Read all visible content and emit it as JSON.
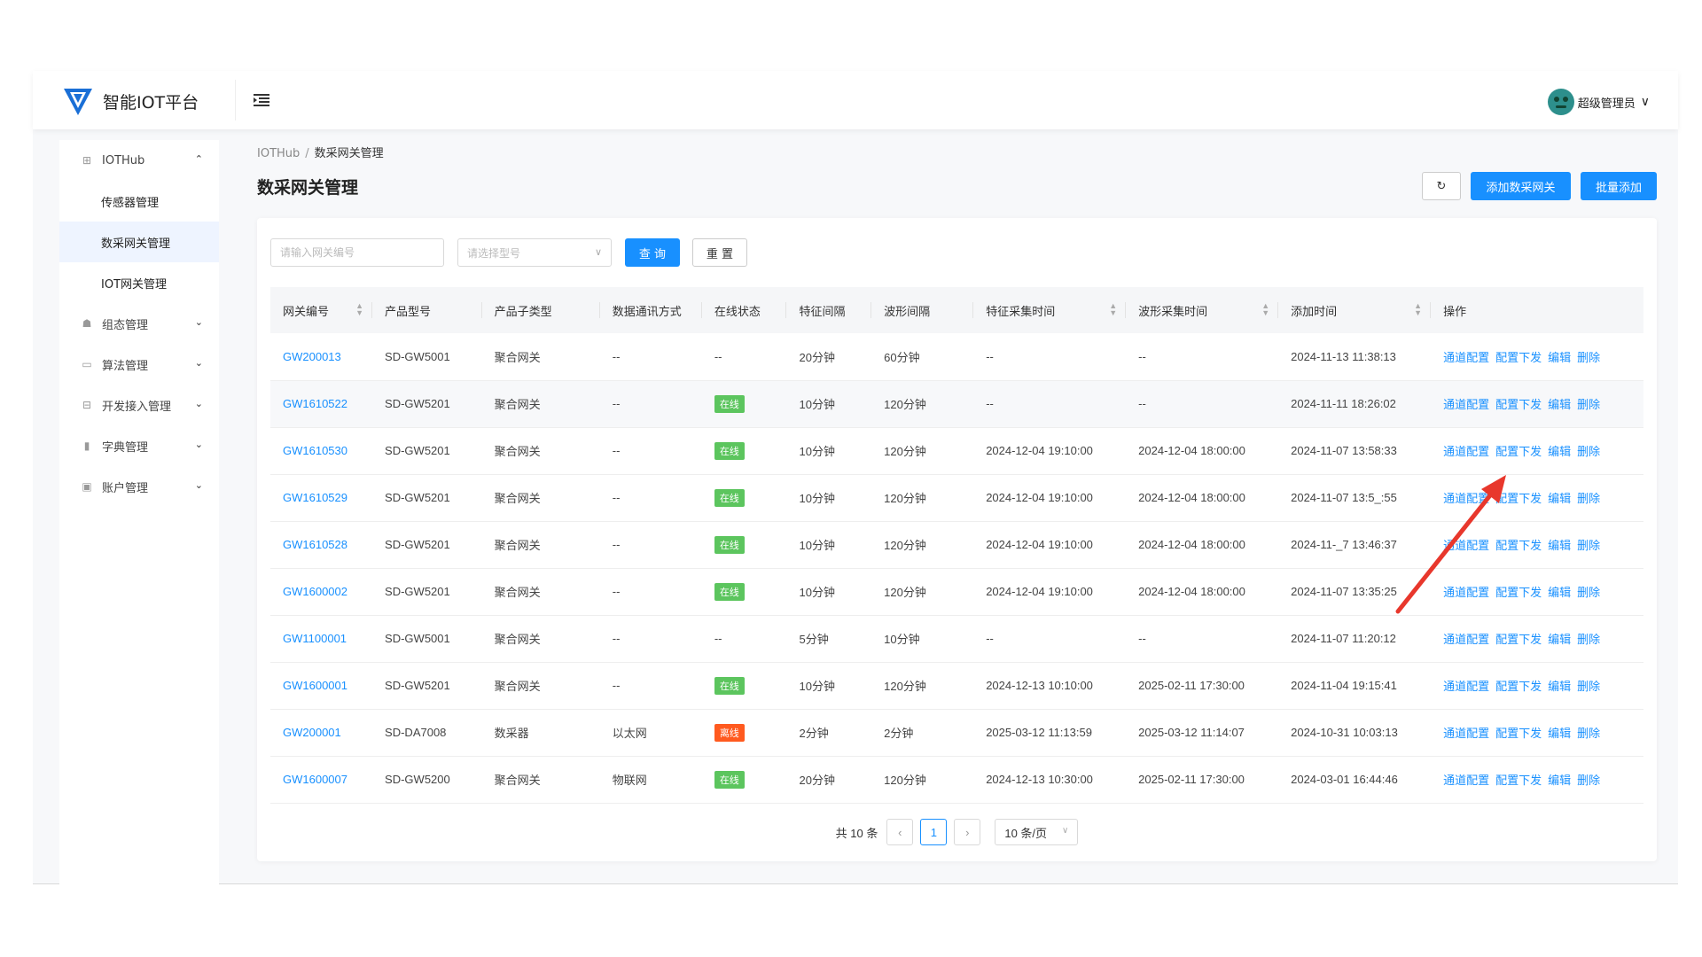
{
  "app": {
    "title": "智能IOT平台"
  },
  "user": {
    "name": "超级管理员"
  },
  "sidebar": {
    "group_iothub": "IOTHub",
    "sub_items": [
      "传感器管理",
      "数采网关管理",
      "IOT网关管理"
    ],
    "groups": [
      "组态管理",
      "算法管理",
      "开发接入管理",
      "字典管理",
      "账户管理"
    ]
  },
  "breadcrumb": {
    "root": "IOTHub",
    "separator": "/",
    "current": "数采网关管理"
  },
  "page": {
    "title": "数采网关管理"
  },
  "toolbar": {
    "refresh_icon": "refresh-icon",
    "add_label": "添加数采网关",
    "batch_label": "批量添加"
  },
  "filter": {
    "code_placeholder": "请输入网关编号",
    "model_placeholder": "请选择型号",
    "query_label": "查 询",
    "reset_label": "重 置"
  },
  "table": {
    "headers": [
      "网关编号",
      "产品型号",
      "产品子类型",
      "数据通讯方式",
      "在线状态",
      "特征间隔",
      "波形间隔",
      "特征采集时间",
      "波形采集时间",
      "添加时间",
      "操作"
    ],
    "actions": [
      "通道配置",
      "配置下发",
      "编辑",
      "删除"
    ],
    "rows": [
      [
        "GW200013",
        "SD-GW5001",
        "聚合网关",
        "--",
        "--",
        "20分钟",
        "60分钟",
        "--",
        "--",
        "2024-11-13 11:38:13"
      ],
      [
        "GW1610522",
        "SD-GW5201",
        "聚合网关",
        "--",
        "在线",
        "10分钟",
        "120分钟",
        "--",
        "--",
        "2024-11-11 18:26:02"
      ],
      [
        "GW1610530",
        "SD-GW5201",
        "聚合网关",
        "--",
        "在线",
        "10分钟",
        "120分钟",
        "2024-12-04 19:10:00",
        "2024-12-04 18:00:00",
        "2024-11-07 13:58:33"
      ],
      [
        "GW1610529",
        "SD-GW5201",
        "聚合网关",
        "--",
        "在线",
        "10分钟",
        "120分钟",
        "2024-12-04 19:10:00",
        "2024-12-04 18:00:00",
        "2024-11-07 13:5_:55"
      ],
      [
        "GW1610528",
        "SD-GW5201",
        "聚合网关",
        "--",
        "在线",
        "10分钟",
        "120分钟",
        "2024-12-04 19:10:00",
        "2024-12-04 18:00:00",
        "2024-11-_7 13:46:37"
      ],
      [
        "GW1600002",
        "SD-GW5201",
        "聚合网关",
        "--",
        "在线",
        "10分钟",
        "120分钟",
        "2024-12-04 19:10:00",
        "2024-12-04 18:00:00",
        "2024-11-07 13:35:25"
      ],
      [
        "GW1100001",
        "SD-GW5001",
        "聚合网关",
        "--",
        "--",
        "5分钟",
        "10分钟",
        "--",
        "--",
        "2024-11-07 11:20:12"
      ],
      [
        "GW1600001",
        "SD-GW5201",
        "聚合网关",
        "--",
        "在线",
        "10分钟",
        "120分钟",
        "2024-12-13 10:10:00",
        "2025-02-11 17:30:00",
        "2024-11-04 19:15:41"
      ],
      [
        "GW200001",
        "SD-DA7008",
        "数采器",
        "以太网",
        "离线",
        "2分钟",
        "2分钟",
        "2025-03-12 11:13:59",
        "2025-03-12 11:14:07",
        "2024-10-31 10:03:13"
      ],
      [
        "GW1600007",
        "SD-GW5200",
        "聚合网关",
        "物联网",
        "在线",
        "20分钟",
        "120分钟",
        "2024-12-13 10:30:00",
        "2025-02-11 17:30:00",
        "2024-03-01 16:44:46"
      ]
    ]
  },
  "pager": {
    "total": "共 10 条",
    "page": "1",
    "size": "10 条/页"
  },
  "colors": {
    "primary": "#1890ff",
    "online": "#5cc55e",
    "offline": "#ff5a1f",
    "annotation": "#e8372c"
  }
}
